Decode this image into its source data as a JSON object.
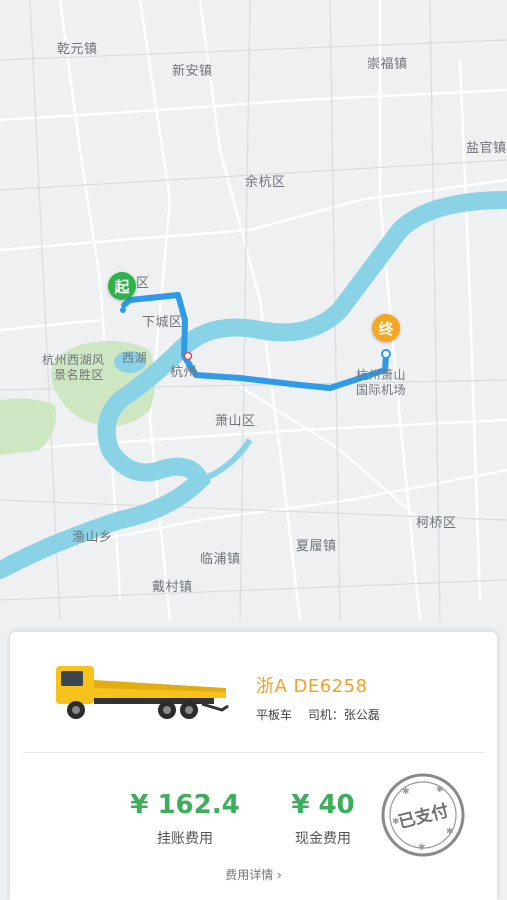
{
  "map": {
    "places": [
      {
        "name": "乾元镇",
        "key": "qianyuan"
      },
      {
        "name": "新安镇",
        "key": "xinan"
      },
      {
        "name": "崇福镇",
        "key": "chongfu"
      },
      {
        "name": "盐官镇",
        "key": "yanguan"
      },
      {
        "name": "余杭区",
        "key": "yuhang"
      },
      {
        "name": "区",
        "key": "qu"
      },
      {
        "name": "下城区",
        "key": "xiacheng"
      },
      {
        "name": "杭州西湖风",
        "key": "xihu1"
      },
      {
        "name": "景名胜区",
        "key": "xihu2"
      },
      {
        "name": "西湖",
        "key": "xihu3"
      },
      {
        "name": "杭州",
        "key": "hangzhou"
      },
      {
        "name": "杭州萧山",
        "key": "airport1"
      },
      {
        "name": "国际机场",
        "key": "airport2"
      },
      {
        "name": "萧山区",
        "key": "xiaoshan"
      },
      {
        "name": "柯桥区",
        "key": "keqiao"
      },
      {
        "name": "渔山乡",
        "key": "yushan"
      },
      {
        "name": "临浦镇",
        "key": "linpu"
      },
      {
        "name": "夏履镇",
        "key": "xialv"
      },
      {
        "name": "戴村镇",
        "key": "daicun"
      }
    ],
    "start_marker": "起",
    "end_marker": "终",
    "colors": {
      "route": "#2f9be8",
      "river": "#8ad3e6",
      "park": "#cfe6c3",
      "start": "#2cb34a",
      "end": "#f5a623"
    }
  },
  "order": {
    "plate": "浙A DE6258",
    "vehicle_type": "平板车",
    "driver": "司机：张公磊",
    "credit_amount": "¥ 162.4",
    "credit_label": "挂账费用",
    "cash_amount": "¥ 40",
    "cash_label": "现金费用",
    "detail_link": "费用详情 ›",
    "stamp_text": "已支付"
  }
}
